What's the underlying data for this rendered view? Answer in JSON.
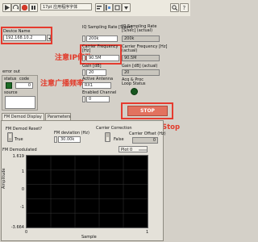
{
  "toolbar": {
    "font_label": "17pt 应用程序字体",
    "icons": [
      "arrow-right-icon",
      "run-continuous-icon",
      "abort-icon",
      "pause-icon",
      "font-dropdown",
      "align-icon",
      "distribute-icon",
      "resize-icon",
      "reorder-icon",
      "search-icon",
      "help-icon"
    ]
  },
  "device": {
    "label": "Device Name",
    "value": "192.168.10.2",
    "annotation": "注意IP修改"
  },
  "error_out": {
    "label": "error out",
    "status_label": "status",
    "code_label": "code",
    "code_value": "0",
    "source_label": "source"
  },
  "iq_rate": {
    "label": "IQ Sampling Rate [S/sec]",
    "value": "200k",
    "actual_label": "IQ Sampling Rate [S/sec] (actual)",
    "actual_value": "200k"
  },
  "carrier": {
    "label": "Carrier Frequency [Hz]",
    "value": "90.5M",
    "actual_label": "Carrier Frequency [Hz] (actual)",
    "actual_value": "90.5M",
    "annotation": "注意广播频率"
  },
  "gain": {
    "label": "Gain [dB]",
    "value": "20",
    "actual_label": "Gain [dB] (actual)",
    "actual_value": "20"
  },
  "antenna": {
    "label": "Active Antenna",
    "value": "RX1"
  },
  "enabled_channel": {
    "label": "Enabled Channel",
    "value": "0"
  },
  "acq_status": {
    "label": "Acq & Proc Loop Status"
  },
  "stop": {
    "label": "STOP",
    "annotation": "运行结束点击Stop"
  },
  "tabs": [
    {
      "label": "FM Demod Display"
    },
    {
      "label": "Parameters"
    }
  ],
  "demod": {
    "reset_label": "FM Demod Reset?",
    "reset_value": "True",
    "deviation_label": "FM deviation (Hz)",
    "deviation_value": "30.00k",
    "carrier_corr_label": "Carrier Correction",
    "carrier_corr_value": "False",
    "carrier_offset_label": "Carrier Offset (Hz)",
    "carrier_offset_value": "0"
  },
  "plot": {
    "title": "FM Demodulated",
    "legend": "Plot 0",
    "ylabel": "Amplitude",
    "xlabel": "Sample",
    "y_ticks": [
      "1.619",
      "1",
      "0",
      "-1",
      "-3.664"
    ],
    "x_ticks": [
      "0",
      "1"
    ]
  }
}
